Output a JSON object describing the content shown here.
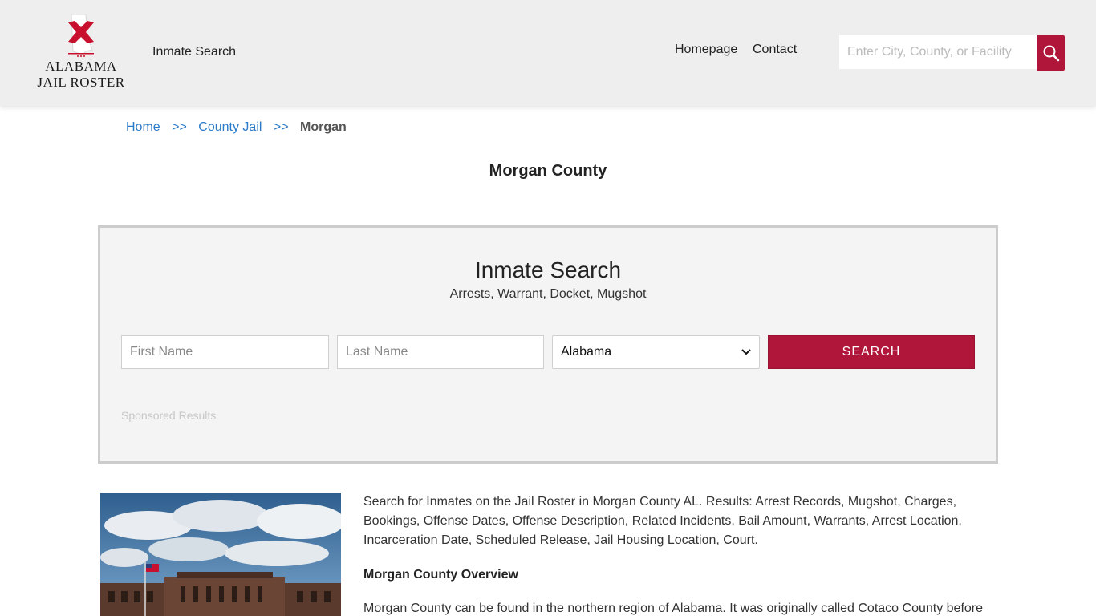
{
  "header": {
    "logo_line1": "ALABAMA",
    "logo_line2": "JAIL ROSTER",
    "nav_inmate_search": "Inmate Search",
    "nav_homepage": "Homepage",
    "nav_contact": "Contact",
    "search_placeholder": "Enter City, County, or Facility",
    "search_icon": "magnifier-icon"
  },
  "breadcrumb": {
    "home": "Home",
    "sep": ">>",
    "county_jail": "County Jail",
    "current": "Morgan"
  },
  "page_title": "Morgan County",
  "search_panel": {
    "title": "Inmate Search",
    "subtitle": "Arrests, Warrant, Docket, Mugshot",
    "first_name_placeholder": "First Name",
    "last_name_placeholder": "Last Name",
    "state_selected": "Alabama",
    "search_button": "SEARCH",
    "sponsored": "Sponsored Results"
  },
  "content": {
    "intro": "Search for Inmates on the Jail Roster in Morgan County AL. Results: Arrest Records, Mugshot, Charges, Bookings, Offense Dates, Offense Description, Related Incidents, Bail Amount, Warrants, Arrest Location, Incarceration Date, Scheduled Release, Jail Housing Location, Court.",
    "overview_heading": "Morgan County Overview",
    "overview_text": "Morgan County can be found in the northern region of Alabama. It was originally called Cotaco County before"
  },
  "colors": {
    "accent": "#b0163a",
    "link": "#2a7ac8",
    "header_bg": "#eeeeee",
    "panel_bg": "#f4f4f4"
  }
}
